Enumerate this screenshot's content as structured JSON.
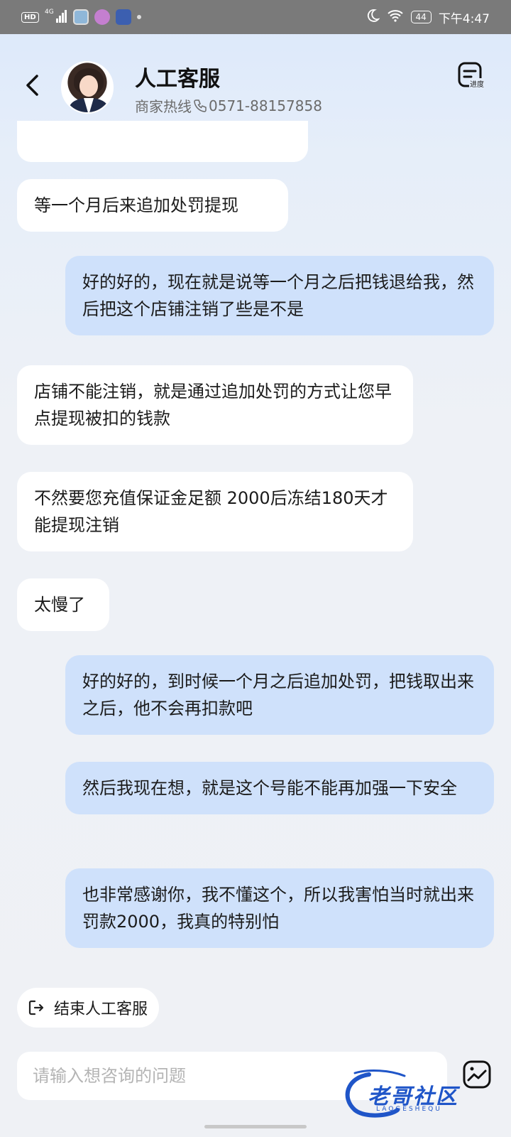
{
  "statusbar": {
    "hd": "HD",
    "network": "4G",
    "battery": "44",
    "time": "下午4:47"
  },
  "header": {
    "title": "人工客服",
    "hotline_label": "商家热线",
    "hotline_number": "0571-88157858",
    "progress_label": "进度"
  },
  "messages": [
    {
      "side": "left",
      "text": "等一个月后来追加处罚提现"
    },
    {
      "side": "right",
      "text": "好的好的，现在就是说等一个月之后把钱退给我，然后把这个店铺注销了些是不是"
    },
    {
      "side": "left",
      "text": "店铺不能注销，就是通过追加处罚的方式让您早点提现被扣的钱款"
    },
    {
      "side": "left",
      "text": "不然要您充值保证金足额 2000后冻结180天才能提现注销"
    },
    {
      "side": "left",
      "text": "太慢了"
    },
    {
      "side": "right",
      "text": "好的好的，到时候一个月之后追加处罚，把钱取出来之后，他不会再扣款吧"
    },
    {
      "side": "right",
      "text": "然后我现在想，就是这个号能不能再加强一下安全"
    },
    {
      "side": "right",
      "text": "也非常感谢你，我不懂这个，所以我害怕当时就出来罚款2000，我真的特别怕"
    }
  ],
  "end_service_label": "结束人工客服",
  "input": {
    "placeholder": "请输入想咨询的问题"
  },
  "watermark": {
    "text": "老哥社区",
    "sub": "LAOGESHEQU"
  },
  "colors": {
    "user_bubble": "#cfe1fb",
    "agent_bubble": "#ffffff",
    "statusbar": "#7a7a7a"
  },
  "icons": [
    "back-arrow-icon",
    "phone-icon",
    "progress-doc-icon",
    "exit-icon",
    "image-icon"
  ]
}
